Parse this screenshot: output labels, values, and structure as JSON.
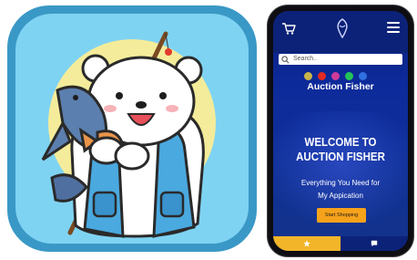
{
  "phone": {
    "search_placeholder": "Search..",
    "brand": "Auction Fisher",
    "welcome_line1": "WELCOME TO",
    "welcome_line2": "AUCTION FISHER",
    "tagline_line1": "Everything You Need for",
    "tagline_line2": "My Appication",
    "cta_label": "Start Shopping"
  },
  "icons": {
    "cart": "cart-icon",
    "logo": "fish-logo-icon",
    "menu": "hamburger-menu-icon",
    "search": "search-icon",
    "home": "star-icon",
    "chat": "chat-icon"
  },
  "colors": {
    "phone_bg": "#0d2a9a",
    "cta": "#f7a21b",
    "tab_active": "#f2b52a",
    "icon_bg": "#3a98c6",
    "icon_sky": "#7fd3f2",
    "icon_sun": "#f4ec9a"
  }
}
